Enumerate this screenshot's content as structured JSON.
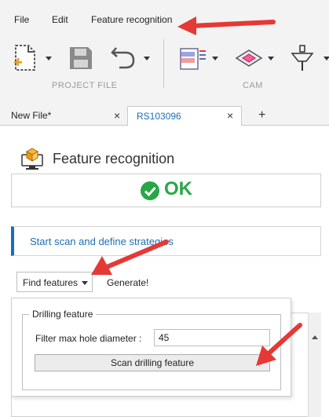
{
  "menu": {
    "file": "File",
    "edit": "Edit",
    "feature_recognition": "Feature recognition"
  },
  "toolbar": {
    "groups": {
      "project_file": "PROJECT FILE",
      "cam": "CAM"
    },
    "buttons": [
      "new-file-icon",
      "save-icon",
      "undo-icon",
      "cam-document-icon",
      "cam-shape-icon",
      "tool-icon"
    ]
  },
  "tabs": [
    {
      "label": "New File*"
    },
    {
      "label": "RS103096",
      "active": true
    }
  ],
  "panel": {
    "title": "Feature recognition",
    "status": "OK",
    "status_color": "#28a745",
    "scan_section": "Start scan and define strategies",
    "find_features": "Find features",
    "generate": "Generate!"
  },
  "popup": {
    "group_title": "Drilling feature",
    "filter_label": "Filter max hole diameter :",
    "filter_value": "45",
    "scan_button": "Scan drilling feature"
  },
  "colors": {
    "accent_blue": "#1b6fb7",
    "ok_green": "#28a745",
    "arrow_red": "#e53935"
  }
}
